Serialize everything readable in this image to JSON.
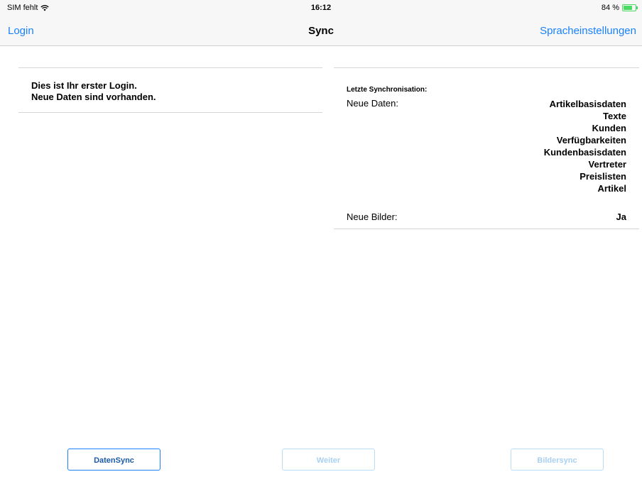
{
  "status": {
    "carrier": "SIM fehlt",
    "time": "16:12",
    "battery": "84 %",
    "battery_level": 0.84,
    "accent": "#4cd964"
  },
  "nav": {
    "left": "Login",
    "title": "Sync",
    "right": "Spracheinstellungen",
    "tint": "#1a82fb"
  },
  "left": {
    "line1": "Dies ist Ihr erster Login.",
    "line2": "Neue Daten sind vorhanden."
  },
  "right": {
    "section_title": "Letzte Synchronisation:",
    "neue_daten_label": "Neue Daten:",
    "neue_daten_items": [
      "Artikelbasisdaten",
      "Texte",
      "Kunden",
      "Verfügbarkeiten",
      "Kundenbasisdaten",
      "Vertreter",
      "Preislisten",
      "Artikel"
    ],
    "neue_bilder_label": "Neue Bilder:",
    "neue_bilder_value": "Ja"
  },
  "buttons": {
    "datensync": "DatenSync",
    "weiter": "Weiter",
    "bildersync": "Bildersync"
  },
  "icons": {
    "wifi": "wifi-icon",
    "battery": "battery-icon"
  }
}
